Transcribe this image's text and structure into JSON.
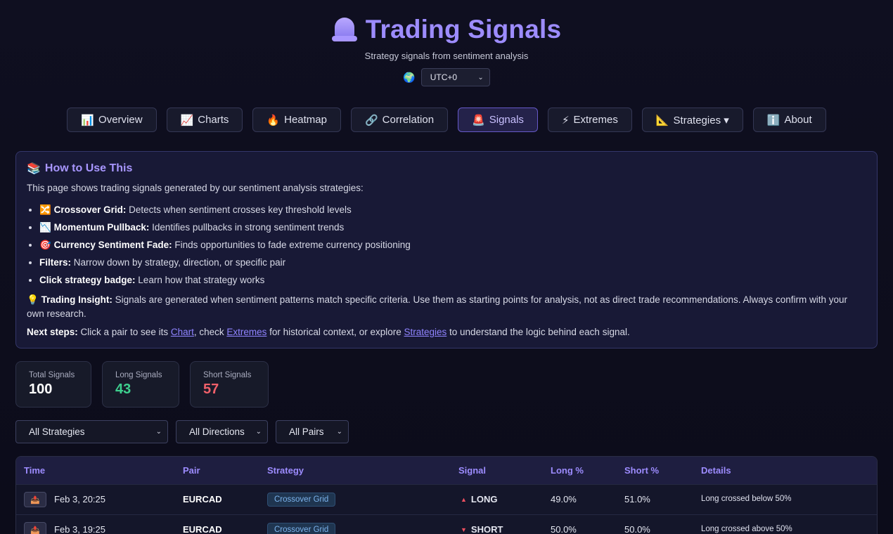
{
  "header": {
    "title": "Trading Signals",
    "subtitle": "Strategy signals from sentiment analysis",
    "globe_icon": "🌍",
    "timezone": "UTC+0"
  },
  "nav": [
    {
      "icon": "📊",
      "label": "Overview"
    },
    {
      "icon": "📈",
      "label": "Charts"
    },
    {
      "icon": "🔥",
      "label": "Heatmap"
    },
    {
      "icon": "🔗",
      "label": "Correlation"
    },
    {
      "icon": "🚨",
      "label": "Signals"
    },
    {
      "icon": "⚡",
      "label": "Extremes"
    },
    {
      "icon": "📐",
      "label": "Strategies ▾"
    },
    {
      "icon": "ℹ️",
      "label": "About"
    }
  ],
  "howto": {
    "icon": "📚",
    "title": "How to Use This",
    "intro": "This page shows trading signals generated by our sentiment analysis strategies:",
    "items": [
      {
        "icon": "🔀",
        "bold": "Crossover Grid:",
        "text": " Detects when sentiment crosses key threshold levels"
      },
      {
        "icon": "📉",
        "bold": "Momentum Pullback:",
        "text": " Identifies pullbacks in strong sentiment trends"
      },
      {
        "icon": "🎯",
        "bold": "Currency Sentiment Fade:",
        "text": " Finds opportunities to fade extreme currency positioning"
      },
      {
        "icon": "",
        "bold": "Filters:",
        "text": " Narrow down by strategy, direction, or specific pair"
      },
      {
        "icon": "",
        "bold": "Click strategy badge:",
        "text": " Learn how that strategy works"
      }
    ],
    "insight_icon": "💡",
    "insight_bold": "Trading Insight:",
    "insight_text": " Signals are generated when sentiment patterns match specific criteria. Use them as starting points for analysis, not as direct trade recommendations. Always confirm with your own research.",
    "next_bold": "Next steps:",
    "next_1": " Click a pair to see its ",
    "link_chart": "Chart",
    "next_2": ", check ",
    "link_extremes": "Extremes",
    "next_3": " for historical context, or explore ",
    "link_strategies": "Strategies",
    "next_4": " to understand the logic behind each signal."
  },
  "stats": [
    {
      "label": "Total Signals",
      "value": "100",
      "color": "#ffffff"
    },
    {
      "label": "Long Signals",
      "value": "43",
      "color": "#3ecf8e"
    },
    {
      "label": "Short Signals",
      "value": "57",
      "color": "#f0606a"
    }
  ],
  "filters": [
    {
      "value": "All Strategies",
      "width": 217
    },
    {
      "value": "All Directions",
      "width": 131
    },
    {
      "value": "All Pairs",
      "width": 104
    }
  ],
  "table": {
    "headers": [
      "Time",
      "Pair",
      "Strategy",
      "Signal",
      "Long %",
      "Short %",
      "Details"
    ],
    "rows": [
      {
        "icon": "📤",
        "time": "Feb 3, 20:25",
        "pair": "EURCAD",
        "strategy": "Crossover Grid",
        "signal": "LONG",
        "dir": "up",
        "long": "49.0%",
        "short": "51.0%",
        "details": "Long crossed below 50%"
      },
      {
        "icon": "📤",
        "time": "Feb 3, 19:25",
        "pair": "EURCAD",
        "strategy": "Crossover Grid",
        "signal": "SHORT",
        "dir": "down",
        "long": "50.0%",
        "short": "50.0%",
        "details": "Long crossed above 50%"
      }
    ]
  },
  "colors": {
    "long": "#f05060",
    "short": "#f05060",
    "accent": "#9d8cff"
  }
}
